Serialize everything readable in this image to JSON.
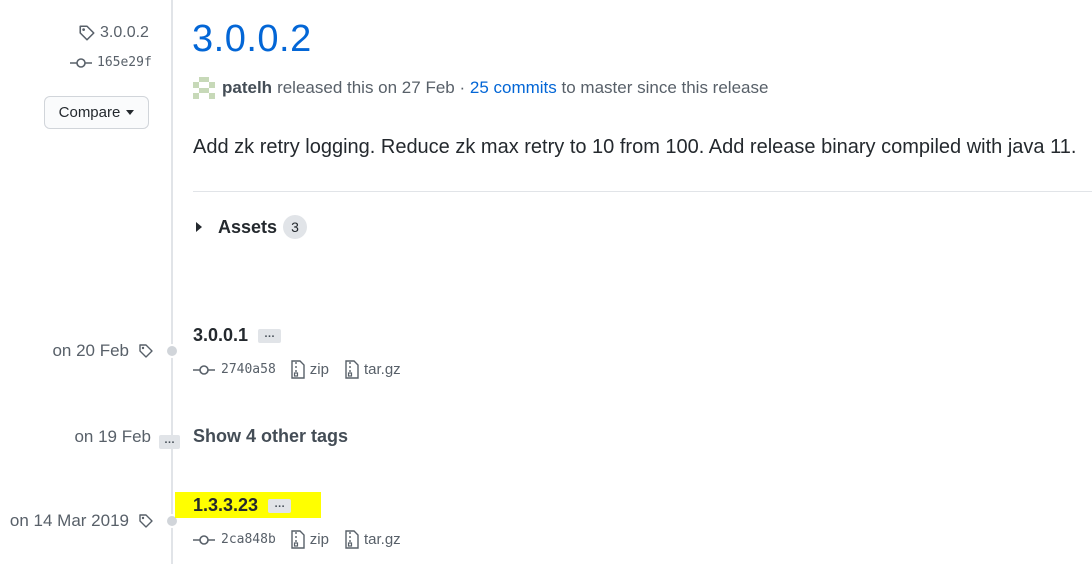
{
  "sidebar": {
    "tag": "3.0.0.2",
    "commit": "165e29f",
    "compare_label": "Compare"
  },
  "release": {
    "title": "3.0.0.2",
    "author": "patelh",
    "released_text": "released this on 27 Feb ·",
    "commits_link": "25 commits",
    "commits_suffix": "to master since this release",
    "notes": "Add zk retry logging. Reduce zk max retry to 10 from 100. Add release binary compiled with java 11.",
    "assets_label": "Assets",
    "assets_count": "3"
  },
  "tags": [
    {
      "date": "on 20 Feb",
      "name": "3.0.0.1",
      "ellipsis": "…",
      "commit": "2740a58",
      "zip": "zip",
      "targz": "tar.gz"
    },
    {
      "date": "on 14 Mar 2019",
      "name": "1.3.3.23",
      "ellipsis": "…",
      "commit": "2ca848b",
      "zip": "zip",
      "targz": "tar.gz"
    }
  ],
  "other_tags": {
    "date": "on 19 Feb",
    "ellipsis": "…",
    "label": "Show 4 other tags"
  },
  "colors": {
    "link": "#0366d6",
    "highlight": "#ffff00",
    "muted": "#586069"
  },
  "icons": [
    "tag-icon",
    "git-commit-icon",
    "file-zip-icon",
    "caret-down-icon",
    "triangle-right-icon",
    "avatar-icon"
  ]
}
